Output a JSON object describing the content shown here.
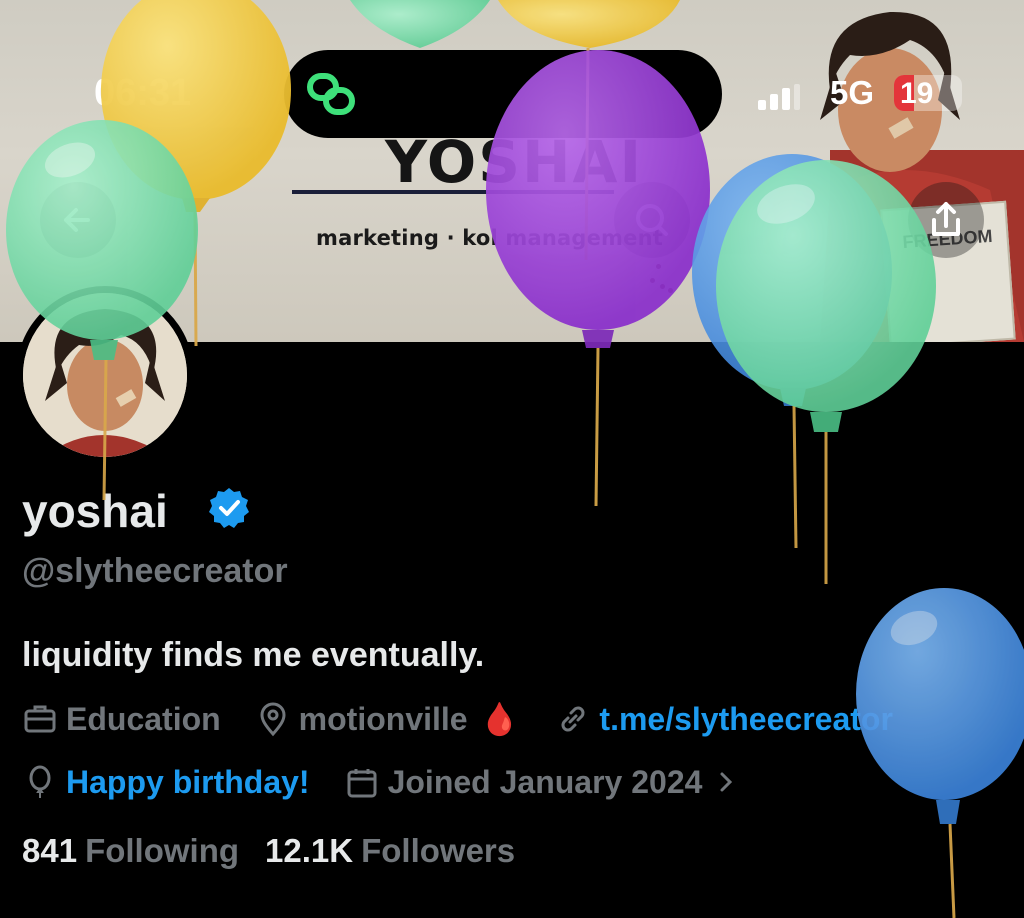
{
  "status_bar": {
    "time": "06:31",
    "network": "5G",
    "battery": "19"
  },
  "banner": {
    "logo_text": "YOSHAI",
    "tagline": "marketing · kol management",
    "newspaper_text": "FREEDOM"
  },
  "profile": {
    "display_name": "yoshai",
    "handle": "@slytheecreator",
    "bio": "liquidity finds me eventually.",
    "category": "Education",
    "location": "motionville",
    "location_emoji": "🩸",
    "website": "t.me/slytheecreator",
    "birthday": "Happy birthday!",
    "joined": "Joined January 2024"
  },
  "stats": {
    "following_count": "841",
    "following_label": "Following",
    "followers_count": "12.1K",
    "followers_label": "Followers"
  },
  "colors": {
    "accent": "#1d9bf0",
    "muted": "#71767b",
    "text": "#e7e9ea",
    "balloon_green": "#7fe0b0",
    "balloon_yellow": "#f5cf48",
    "balloon_purple": "#9b3fd6",
    "balloon_blue": "#4a90e2"
  }
}
